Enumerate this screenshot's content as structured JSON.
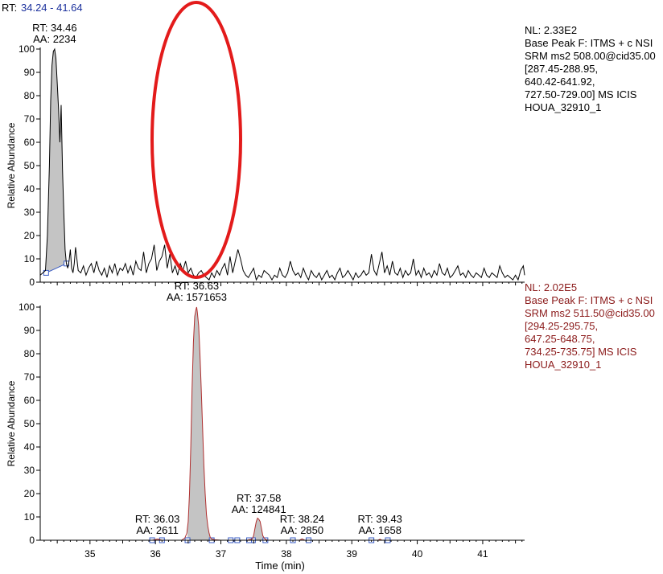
{
  "range_label": {
    "prefix": "RT:",
    "value": "34.24 - 41.64"
  },
  "x_axis_title": "Time (min)",
  "chart_data": [
    {
      "type": "line",
      "ylabel": "Relative Abundance",
      "xlim": [
        34.24,
        41.64
      ],
      "ylim": [
        0,
        100
      ],
      "y_ticks": [
        0,
        10,
        20,
        30,
        40,
        50,
        60,
        70,
        80,
        90,
        100
      ],
      "info": [
        "NL: 2.33E2",
        "Base Peak F: ITMS + c NSI",
        "SRM ms2 508.00@cid35.00",
        "[287.45-288.95,",
        "640.42-641.92,",
        "727.50-729.00]  MS  ICIS",
        "HOUA_32910_1"
      ],
      "info_color": "#000000",
      "trace_color": "#000000",
      "annotations": [
        {
          "rt": "RT: 34.46",
          "aa": "AA: 2234",
          "x": 34.46,
          "y": 100
        }
      ],
      "peaks": [
        {
          "x_start": 34.33,
          "x_end": 34.64,
          "baseline_start": 4,
          "baseline_end": 8
        }
      ],
      "x": [
        34.24,
        34.28,
        34.32,
        34.35,
        34.38,
        34.4,
        34.42,
        34.44,
        34.46,
        34.48,
        34.5,
        34.52,
        34.54,
        34.56,
        34.58,
        34.6,
        34.62,
        34.64,
        34.66,
        34.68,
        34.7,
        34.72,
        34.74,
        34.76,
        34.78,
        34.82,
        34.86,
        34.9,
        34.94,
        34.98,
        35.02,
        35.06,
        35.1,
        35.14,
        35.18,
        35.22,
        35.26,
        35.3,
        35.34,
        35.38,
        35.42,
        35.46,
        35.5,
        35.54,
        35.58,
        35.62,
        35.66,
        35.7,
        35.74,
        35.78,
        35.82,
        35.86,
        35.9,
        35.94,
        35.98,
        36.02,
        36.06,
        36.1,
        36.14,
        36.18,
        36.22,
        36.26,
        36.3,
        36.34,
        36.38,
        36.42,
        36.46,
        36.5,
        36.54,
        36.58,
        36.62,
        36.66,
        36.7,
        36.74,
        36.78,
        36.82,
        36.86,
        36.9,
        36.94,
        36.98,
        37.02,
        37.06,
        37.1,
        37.14,
        37.18,
        37.22,
        37.26,
        37.3,
        37.34,
        37.38,
        37.42,
        37.46,
        37.5,
        37.54,
        37.58,
        37.62,
        37.66,
        37.7,
        37.74,
        37.78,
        37.82,
        37.86,
        37.9,
        37.94,
        37.98,
        38.02,
        38.06,
        38.1,
        38.14,
        38.18,
        38.22,
        38.26,
        38.3,
        38.34,
        38.38,
        38.42,
        38.46,
        38.5,
        38.54,
        38.58,
        38.62,
        38.66,
        38.7,
        38.74,
        38.78,
        38.82,
        38.86,
        38.9,
        38.94,
        38.98,
        39.02,
        39.06,
        39.1,
        39.14,
        39.18,
        39.22,
        39.26,
        39.3,
        39.34,
        39.38,
        39.42,
        39.46,
        39.5,
        39.54,
        39.58,
        39.62,
        39.66,
        39.7,
        39.74,
        39.78,
        39.82,
        39.86,
        39.9,
        39.94,
        39.98,
        40.02,
        40.06,
        40.1,
        40.14,
        40.18,
        40.22,
        40.26,
        40.3,
        40.34,
        40.38,
        40.42,
        40.46,
        40.5,
        40.54,
        40.58,
        40.62,
        40.66,
        40.7,
        40.74,
        40.78,
        40.82,
        40.86,
        40.9,
        40.94,
        40.98,
        41.02,
        41.06,
        41.1,
        41.14,
        41.18,
        41.22,
        41.26,
        41.3,
        41.34,
        41.38,
        41.42,
        41.46,
        41.5,
        41.54,
        41.58,
        41.62,
        41.64
      ],
      "y": [
        3,
        4,
        5,
        20,
        50,
        78,
        93,
        99,
        100,
        96,
        85,
        74,
        60,
        76,
        48,
        30,
        14,
        8,
        6,
        9,
        14,
        6,
        4,
        8,
        15,
        5,
        4,
        7,
        3,
        6,
        8,
        4,
        9,
        5,
        3,
        6,
        2,
        7,
        4,
        8,
        3,
        6,
        5,
        8,
        4,
        7,
        3,
        9,
        6,
        5,
        13,
        4,
        8,
        10,
        16,
        5,
        9,
        11,
        16,
        6,
        12,
        4,
        7,
        3,
        8,
        5,
        9,
        4,
        6,
        3,
        2,
        4,
        5,
        3,
        2,
        1,
        4,
        2,
        5,
        3,
        6,
        8,
        3,
        11,
        4,
        9,
        14,
        10,
        5,
        3,
        2,
        4,
        6,
        1,
        3,
        2,
        5,
        4,
        3,
        1,
        3,
        2,
        6,
        3,
        2,
        4,
        9,
        5,
        3,
        4,
        2,
        6,
        3,
        1,
        5,
        3,
        2,
        4,
        1,
        3,
        5,
        2,
        3,
        1,
        4,
        6,
        2,
        3,
        5,
        3,
        1,
        4,
        2,
        3,
        5,
        3,
        4,
        12,
        5,
        3,
        8,
        13,
        4,
        7,
        3,
        9,
        4,
        3,
        6,
        2,
        5,
        3,
        4,
        10,
        3,
        5,
        2,
        6,
        3,
        4,
        2,
        5,
        3,
        8,
        4,
        3,
        6,
        2,
        3,
        5,
        7,
        3,
        4,
        2,
        5,
        3,
        2,
        4,
        3,
        2,
        6,
        3,
        2,
        4,
        3,
        2,
        7,
        4,
        2,
        3,
        2,
        1,
        3,
        1,
        5,
        7,
        3,
        2,
        1
      ]
    },
    {
      "type": "line",
      "ylabel": "Relative Abundance",
      "xlabel": "Time (min)",
      "xlim": [
        34.24,
        41.64
      ],
      "ylim": [
        0,
        100
      ],
      "y_ticks": [
        0,
        10,
        20,
        30,
        40,
        50,
        60,
        70,
        80,
        90,
        100
      ],
      "x_ticks": [
        35,
        36,
        37,
        38,
        39,
        40,
        41
      ],
      "info": [
        "NL: 2.02E5",
        "Base Peak F: ITMS + c NSI",
        "SRM ms2 511.50@cid35.00",
        "[294.25-295.75,",
        "647.25-648.75,",
        "734.25-735.75]  MS  ICIS",
        "HOUA_32910_1"
      ],
      "info_color": "#8b1a1a",
      "trace_color": "#b03030",
      "annotations": [
        {
          "rt": "RT: 36.63",
          "aa": "AA: 1571653",
          "x": 36.63,
          "y": 100
        },
        {
          "rt": "RT: 37.58",
          "aa": "AA: 124841",
          "x": 37.58,
          "y": 9
        },
        {
          "rt": "RT: 36.03",
          "aa": "AA: 2611",
          "x": 36.03,
          "y": 0
        },
        {
          "rt": "RT: 38.24",
          "aa": "AA: 2850",
          "x": 38.24,
          "y": 0
        },
        {
          "rt": "RT: 39.43",
          "aa": "AA: 1658",
          "x": 39.43,
          "y": 0
        }
      ],
      "peaks": [
        {
          "x_start": 36.49,
          "x_end": 36.86,
          "baseline_start": 0,
          "baseline_end": 0
        },
        {
          "x_start": 37.49,
          "x_end": 37.68,
          "baseline_start": 0,
          "baseline_end": 0
        }
      ],
      "x": [
        34.24,
        35.0,
        35.6,
        35.95,
        36.0,
        36.03,
        36.06,
        36.1,
        36.4,
        36.45,
        36.48,
        36.5,
        36.52,
        36.54,
        36.56,
        36.58,
        36.6,
        36.62,
        36.63,
        36.64,
        36.66,
        36.68,
        36.7,
        36.72,
        36.74,
        36.76,
        36.78,
        36.8,
        36.82,
        36.84,
        36.86,
        36.9,
        37.0,
        37.4,
        37.48,
        37.5,
        37.52,
        37.54,
        37.56,
        37.58,
        37.6,
        37.62,
        37.64,
        37.66,
        37.68,
        37.72,
        38.2,
        38.24,
        38.28,
        39.4,
        39.43,
        39.46,
        40.0,
        41.64
      ],
      "y": [
        0,
        0,
        0,
        0,
        0.3,
        0.5,
        0.3,
        0,
        0,
        1,
        3,
        8,
        20,
        40,
        65,
        85,
        96,
        99,
        100,
        98,
        92,
        80,
        65,
        48,
        32,
        20,
        11,
        6,
        3,
        1,
        0.5,
        0.2,
        0,
        0,
        0.5,
        2,
        5,
        8,
        9.5,
        9,
        8,
        5,
        2,
        1,
        0.3,
        0,
        0,
        0.6,
        0,
        0,
        0.4,
        0,
        0,
        0
      ]
    }
  ]
}
